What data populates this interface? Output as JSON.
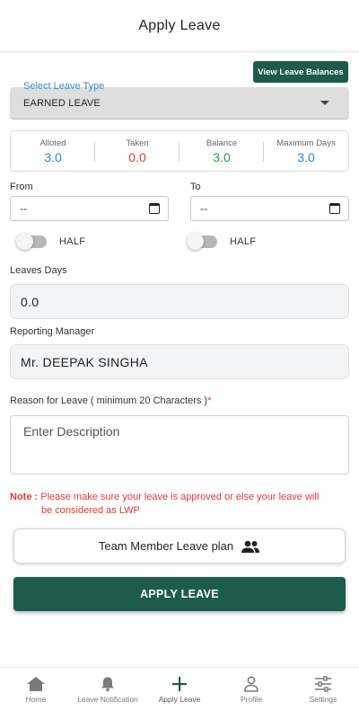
{
  "header": {
    "title": "Apply Leave"
  },
  "balances_button": {
    "label": "View Leave Balances"
  },
  "leave_type": {
    "label": "Select Leave Type",
    "value": "EARNED LEAVE"
  },
  "stats": [
    {
      "label": "Alloted",
      "value": "3.0",
      "color": "#1e88e5"
    },
    {
      "label": "Taken",
      "value": "0.0",
      "color": "#e53935"
    },
    {
      "label": "Balance",
      "value": "3.0",
      "color": "#2e9a3a"
    },
    {
      "label": "Maximum Days",
      "value": "3.0",
      "color": "#1e88e5"
    }
  ],
  "from": {
    "label": "From",
    "value": "--"
  },
  "to": {
    "label": "To",
    "value": "--"
  },
  "half_from": {
    "label": "HALF",
    "on": false
  },
  "half_to": {
    "label": "HALF",
    "on": false
  },
  "leave_days": {
    "label": "Leaves Days",
    "value": "0.0"
  },
  "manager": {
    "label": "Reporting Manager",
    "value": "Mr. DEEPAK SINGHA"
  },
  "reason": {
    "label": "Reason for Leave ( minimum 20 Characters )",
    "required_mark": "*",
    "placeholder": "Enter Description"
  },
  "note": {
    "key": "Note :",
    "line1": "Please make sure your leave is approved or else your leave will",
    "line2": "be considered as LWP"
  },
  "team_plan_button": {
    "label": "Team Member Leave plan",
    "icon": "group-icon"
  },
  "apply_button": {
    "label": "APPLY LEAVE"
  },
  "bottom_nav": [
    {
      "label": "Home",
      "icon": "home-icon"
    },
    {
      "label": "Leave Notification",
      "icon": "bell-icon"
    },
    {
      "label": "Apply Leave",
      "icon": "plus-icon",
      "active": true
    },
    {
      "label": "Profile",
      "icon": "person-icon"
    },
    {
      "label": "Settings",
      "icon": "sliders-icon"
    }
  ],
  "colors": {
    "primary": "#1f5a4f",
    "accent_blue": "#3a8ad6",
    "error": "#e53935"
  }
}
